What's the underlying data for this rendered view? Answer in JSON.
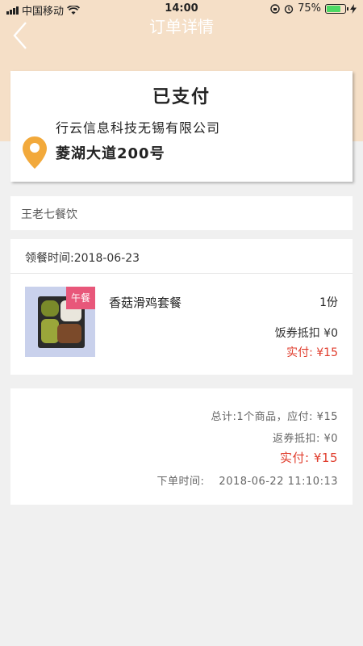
{
  "status_bar": {
    "carrier": "中国移动",
    "time": "14:00",
    "battery": "75%",
    "icons": [
      "signal-icon",
      "wifi-icon",
      "orientation-lock-icon",
      "alarm-icon",
      "battery-icon",
      "charging-icon"
    ]
  },
  "nav": {
    "title": "订单详情",
    "back_icon": "chevron-left-icon"
  },
  "order": {
    "status": "已支付",
    "company": "行云信息科技无锡有限公司",
    "address": "菱湖大道200号",
    "location_icon": "map-pin-icon"
  },
  "restaurant": {
    "name": "王老七餐饮"
  },
  "meal": {
    "pickup_time": "领餐时间:2018-06-23",
    "tag": "午餐",
    "name": "香菇滑鸡套餐",
    "quantity": "1份",
    "voucher": "饭券抵扣  ¥0",
    "paid": "实付: ¥15"
  },
  "summary": {
    "total": "总计:1个商品，应付:  ¥15",
    "rebate": "返券抵扣:  ¥0",
    "paid": "实付:  ¥15",
    "order_time_label": "下单时间:",
    "order_time_value": "2018-06-22 11:10:13"
  },
  "colors": {
    "hero_background": "#f5dfc7",
    "accent_red": "#e03c2c",
    "tag_pink": "#e8577a",
    "pin_orange": "#f2a93b",
    "page_background": "#f0f0f0"
  }
}
